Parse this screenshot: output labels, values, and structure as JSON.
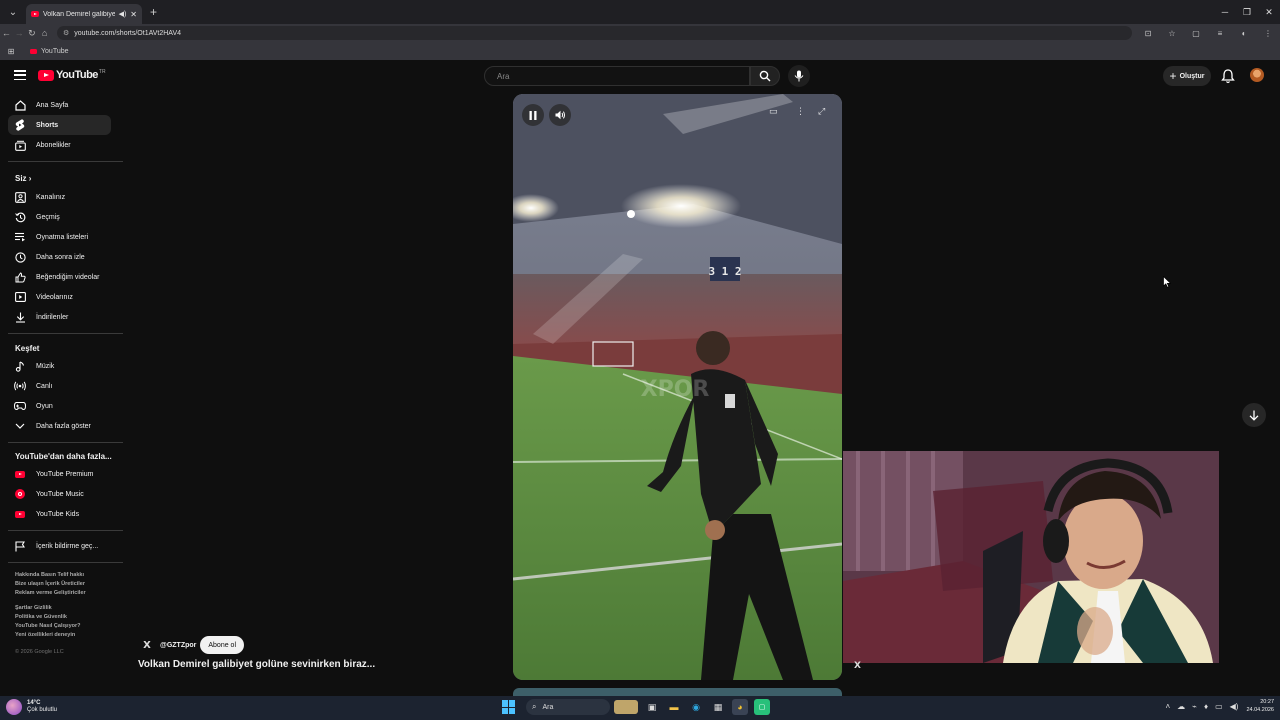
{
  "browser": {
    "tab_title": "Volkan Demirel galibiyet g...",
    "url": "youtube.com/shorts/Ot1AVt2HAV4",
    "bookmark": "YouTube"
  },
  "header": {
    "logo_text": "YouTube",
    "logo_region": "TR",
    "search_placeholder": "Ara",
    "create_label": "Oluştur"
  },
  "sidebar": {
    "main": [
      "Ana Sayfa",
      "Shorts",
      "Abonelikler"
    ],
    "you_heading": "Siz",
    "you_items": [
      "Kanalınız",
      "Geçmiş",
      "Oynatma listeleri",
      "Daha sonra izle",
      "Beğendiğim videolar",
      "Videolarınız",
      "İndirilenler"
    ],
    "explore_heading": "Keşfet",
    "explore_items": [
      "Müzik",
      "Canlı",
      "Oyun",
      "Daha fazla göster"
    ],
    "more_heading": "YouTube'dan daha fazla...",
    "more_items": [
      "YouTube Premium",
      "YouTube Music",
      "YouTube Kids"
    ],
    "report": "İçerik bildirme geç...",
    "footer1": [
      "Hakkında  Basın  Telif hakkı",
      "Bize ulaşın  İçerik Üreticiler",
      "Reklam verme  Geliştiriciler"
    ],
    "footer2": [
      "Şartlar  Gizlilik",
      "Politika ve Güvenlik",
      "YouTube Nasıl Çalışıyor?",
      "Yeni özellikleri deneyin"
    ],
    "copyright": "© 2026 Google LLC"
  },
  "short": {
    "channel": "@GZTZpor",
    "subscribe_label": "Abone ol",
    "title": "Volkan Demirel galibiyet golüne sevinirken biraz...",
    "scoreboard": "3 1 2",
    "watermark": "XPOR"
  },
  "taskbar": {
    "temperature": "14°C",
    "weather": "Çok bulutlu",
    "search_label": "Ara",
    "time": "20:27",
    "date": "24.04.2026"
  },
  "colors": {
    "youtube_red": "#ff0033",
    "background": "#0f0f0f",
    "taskbar": "#1c2330"
  }
}
